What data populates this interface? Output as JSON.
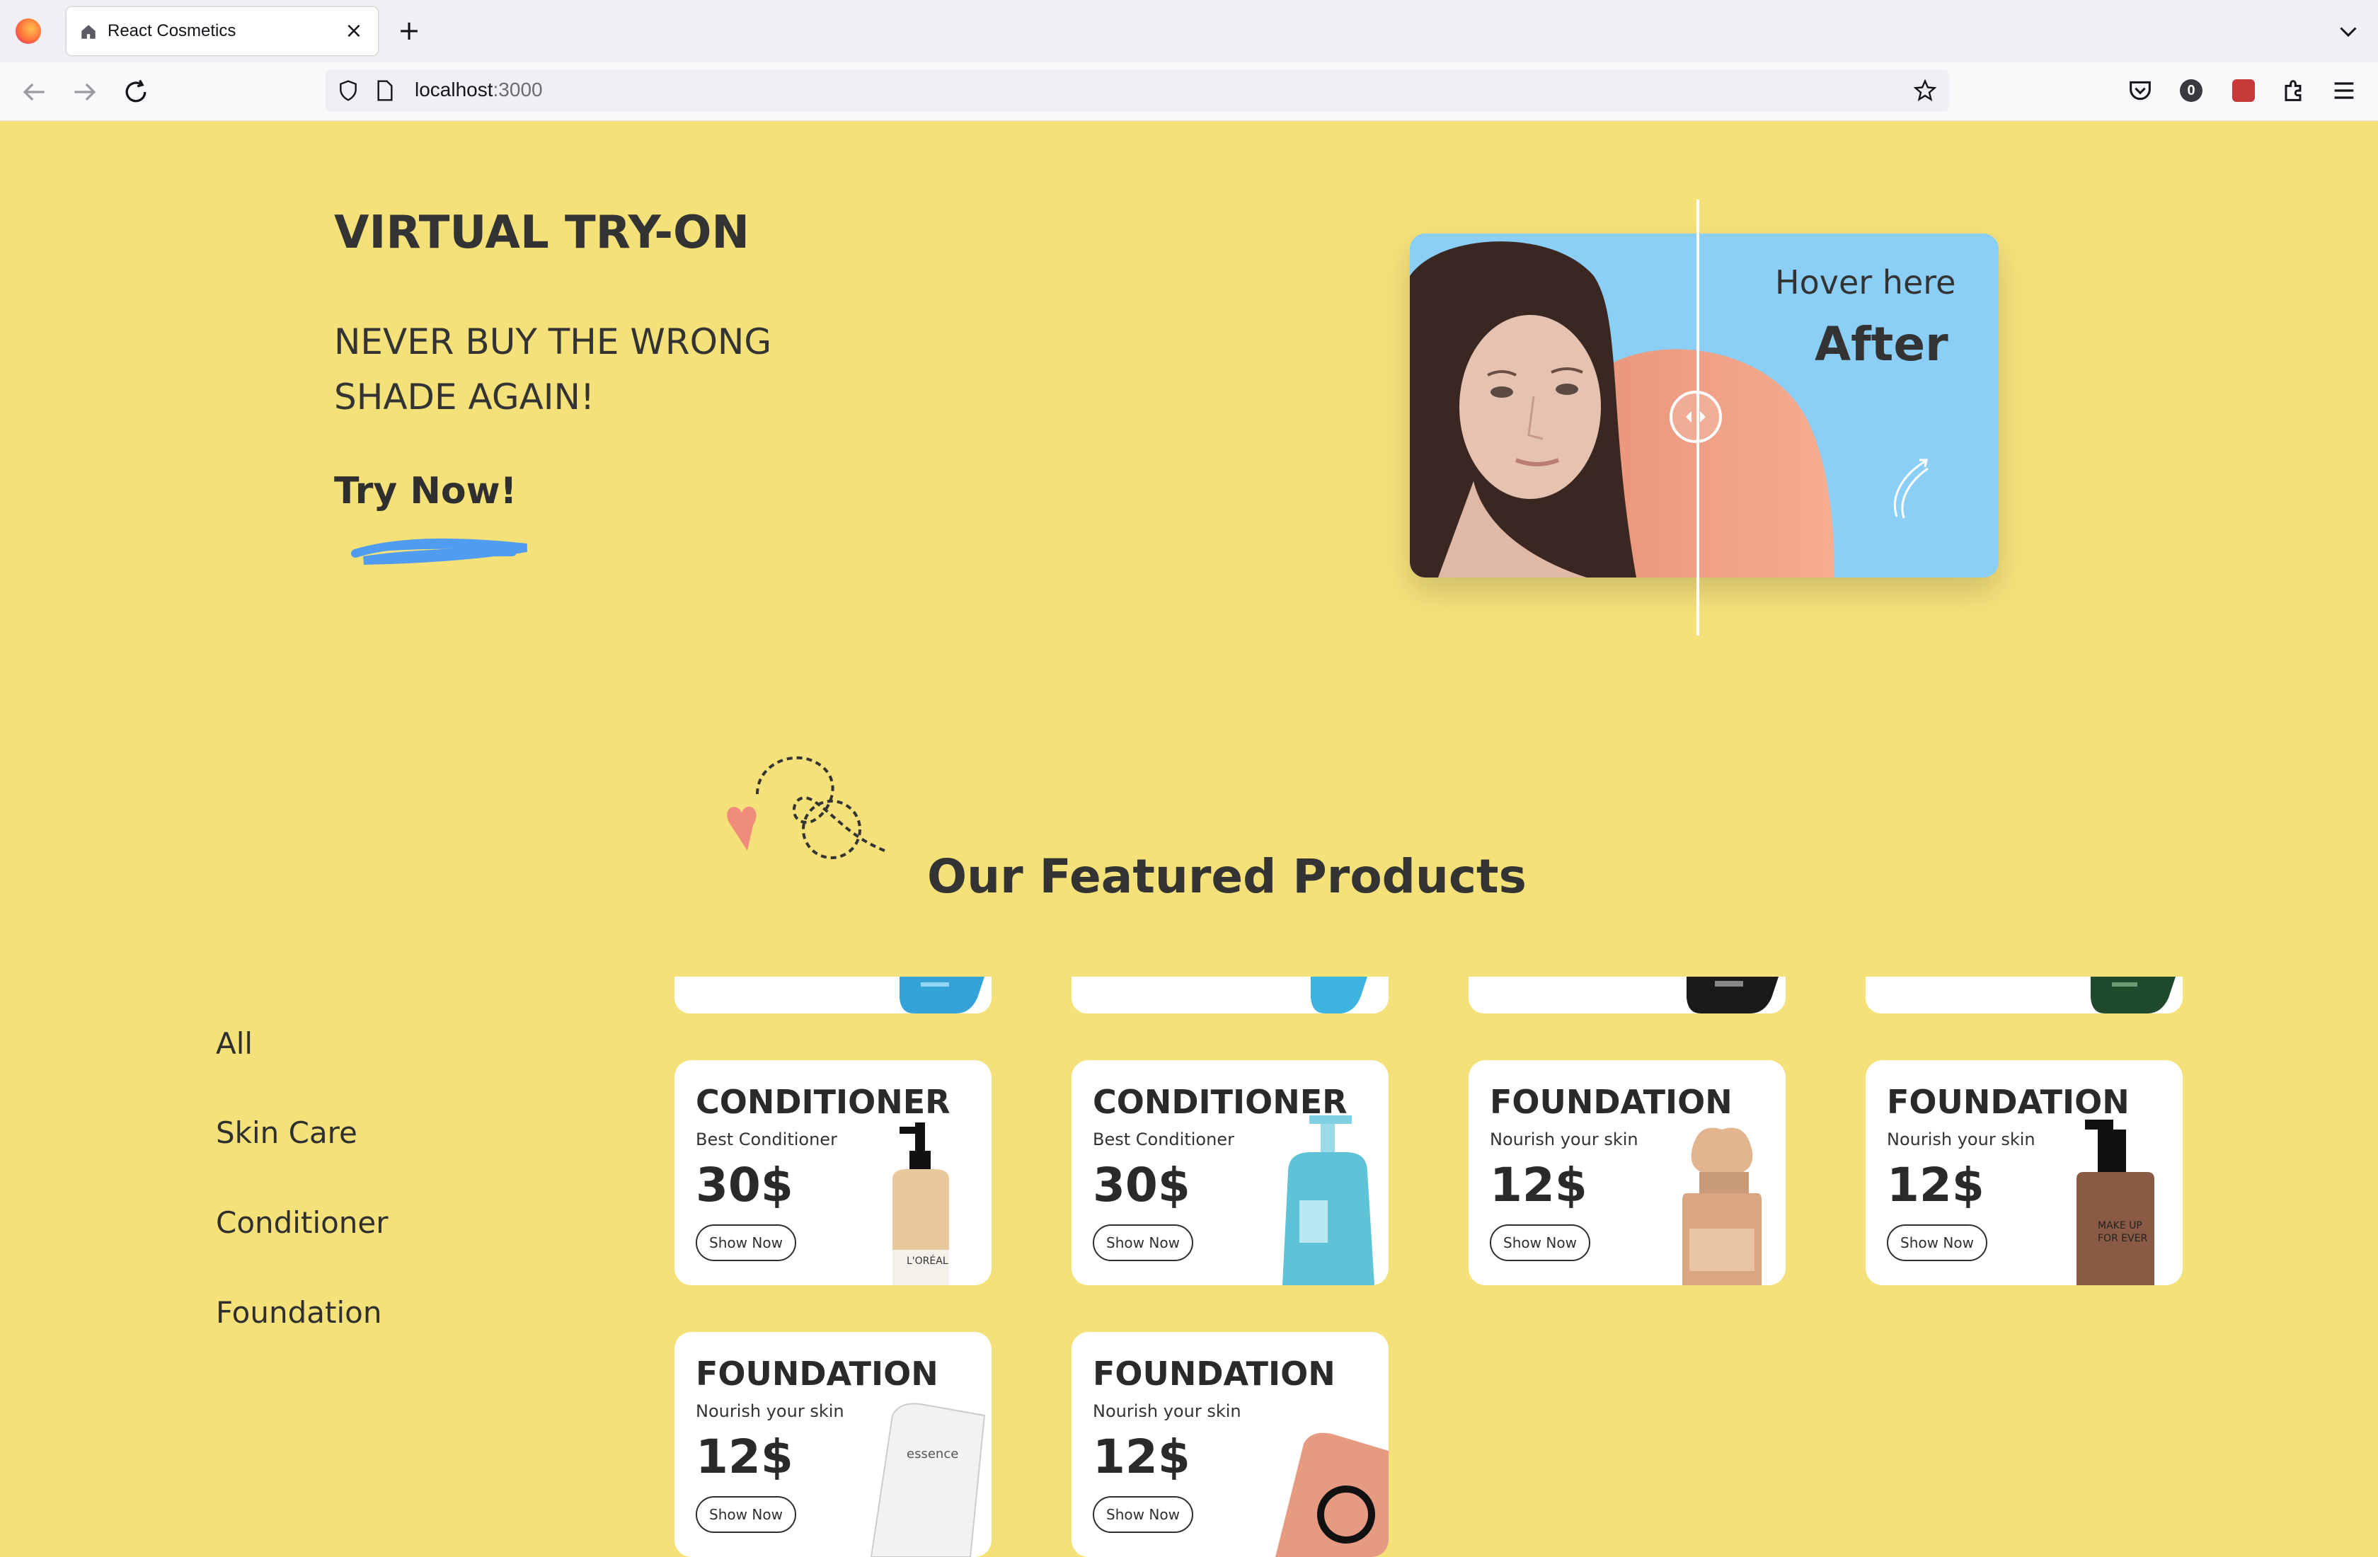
{
  "browser": {
    "tab_title": "React Cosmetics",
    "url_host": "localhost",
    "url_port": ":3000",
    "toolbar_badge": "0"
  },
  "hero": {
    "title": "VIRTUAL TRY-ON",
    "subtitle": "NEVER BUY THE WRONG SHADE AGAIN!",
    "cta": "Try Now!",
    "compare_hint": "Hover here",
    "compare_label": "After"
  },
  "featured": {
    "title": "Our Featured Products"
  },
  "categories": [
    "All",
    "Skin Care",
    "Conditioner",
    "Foundation"
  ],
  "products": [
    {
      "title": "CONDITIONER",
      "subtitle": "Best Conditioner",
      "price": "30$",
      "button": "Show Now",
      "icon": "conditioner-bottle-loreal"
    },
    {
      "title": "CONDITIONER",
      "subtitle": "Best Conditioner",
      "price": "30$",
      "button": "Show Now",
      "icon": "conditioner-pump-blue"
    },
    {
      "title": "FOUNDATION",
      "subtitle": "Nourish your skin",
      "price": "12$",
      "button": "Show Now",
      "icon": "foundation-bottle-beige"
    },
    {
      "title": "FOUNDATION",
      "subtitle": "Nourish your skin",
      "price": "12$",
      "button": "Show Now",
      "icon": "foundation-pump-brown"
    },
    {
      "title": "FOUNDATION",
      "subtitle": "Nourish your skin",
      "price": "12$",
      "button": "Show Now",
      "icon": "foundation-tube-white"
    },
    {
      "title": "FOUNDATION",
      "subtitle": "Nourish your skin",
      "price": "12$",
      "button": "Show Now",
      "icon": "foundation-tube-pink"
    }
  ],
  "colors": {
    "page_bg": "#f4e17a",
    "text_dark": "#333333",
    "compare_bg": "#8ccff6",
    "compare_accent": "#f3a384",
    "brush_blue": "#4f9cf0",
    "heart": "#ef8c7b"
  }
}
